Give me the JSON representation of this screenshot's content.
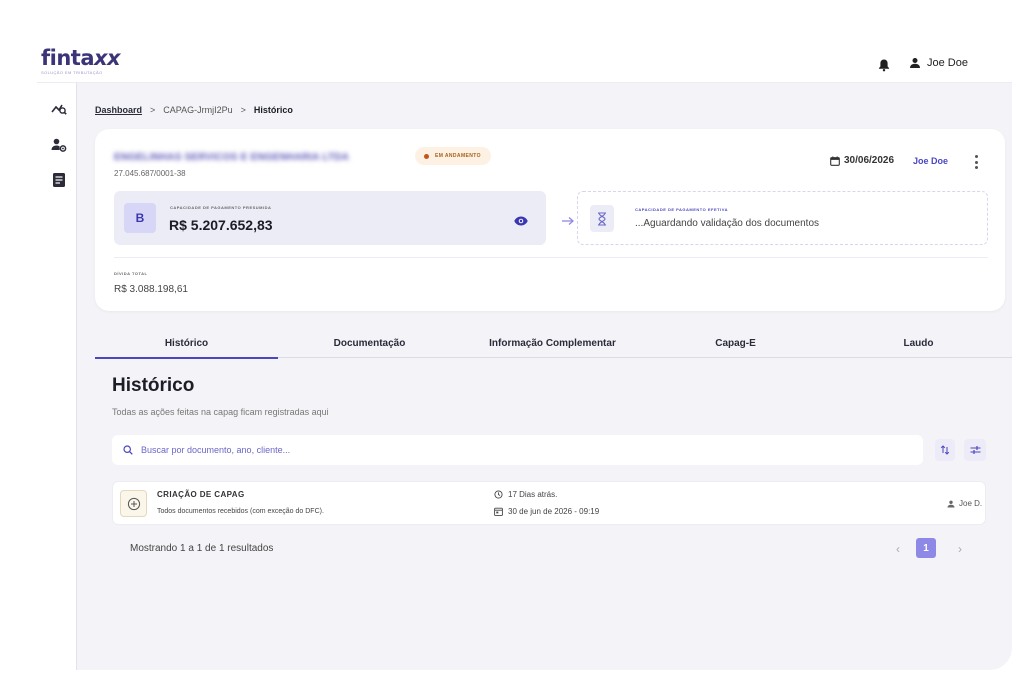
{
  "brand": {
    "name": "fintaxx",
    "name_main": "finta",
    "name_xx": "xx",
    "tagline": "solução em tributação"
  },
  "header": {
    "user_name": "Joe Doe"
  },
  "sidebar": {
    "items": [
      {
        "icon": "analytics-icon"
      },
      {
        "icon": "user-settings-icon"
      },
      {
        "icon": "document-icon"
      }
    ]
  },
  "breadcrumb": {
    "root": "Dashboard",
    "separator": ">",
    "middle": "CAPAG-JrmjI2Pu",
    "current": "Histórico"
  },
  "company": {
    "name": "ENGELINHAS SERVICOS E ENGENHARIA LTDA",
    "status": "EM ANDAMENTO",
    "cnpj": "27.045.687/0001-38",
    "date": "30/06/2026",
    "user": "Joe Doe"
  },
  "capacity_presumed": {
    "letter": "B",
    "label": "CAPACIDADE DE PAGAMENTO PRESUMIDA",
    "value": "R$ 5.207.652,83"
  },
  "capacity_effective": {
    "label": "CAPACIDADE DE PAGAMENTO EFETIVA",
    "value": "...Aguardando validação dos documentos"
  },
  "debt": {
    "label": "DÍVIDA TOTAL",
    "value": "R$ 3.088.198,61"
  },
  "tabs": [
    {
      "label": "Histórico",
      "active": true
    },
    {
      "label": "Documentação",
      "active": false
    },
    {
      "label": "Informação Complementar",
      "active": false
    },
    {
      "label": "Capag-E",
      "active": false
    },
    {
      "label": "Laudo",
      "active": false
    }
  ],
  "history": {
    "title": "Histórico",
    "subtitle": "Todas as ações feitas na capag ficam registradas aqui",
    "search_placeholder": "Buscar por documento, ano, cliente...",
    "rows": [
      {
        "title": "CRIAÇÃO DE CAPAG",
        "description": "Todos documentos recebidos (com exceção do DFC).",
        "relative_time": "17 Dias atrás.",
        "datetime": "30 de jun de 2026 - 09:19",
        "user": "Joe D."
      }
    ],
    "results_text": "Mostrando 1 a 1 de 1 resultados",
    "pagination": {
      "prev": "‹",
      "current": "1",
      "next": "›"
    }
  },
  "colors": {
    "accent": "#4b46c2",
    "brand": "#3b3478",
    "status_bg": "#fdf1e4",
    "status_text": "#a5601a",
    "page_active": "#8e89e6"
  }
}
